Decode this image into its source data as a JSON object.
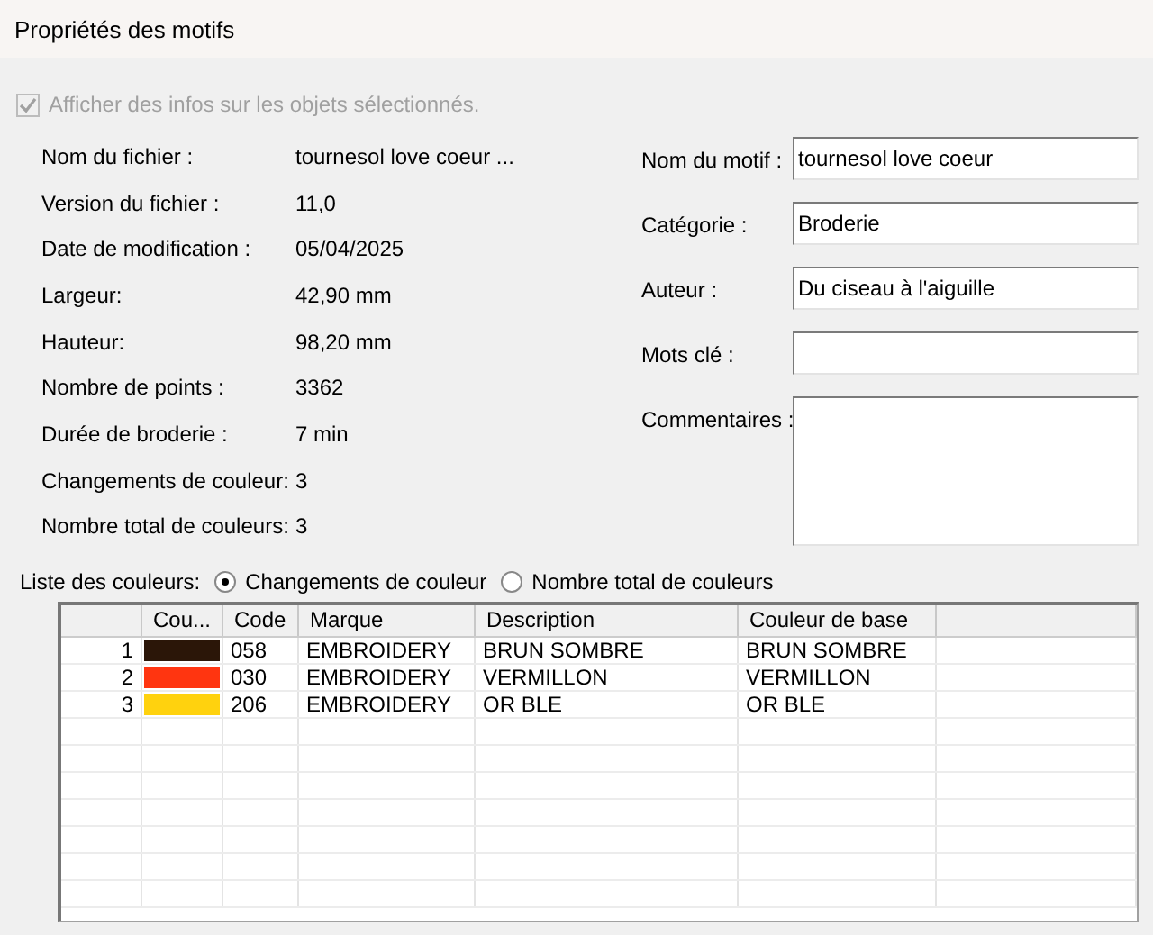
{
  "window": {
    "title": "Propriétés des motifs"
  },
  "show_info": {
    "label": "Afficher des infos sur les objets sélectionnés.",
    "checked": true,
    "disabled": true
  },
  "info": [
    {
      "label": "Nom du fichier :",
      "value": "tournesol love coeur ..."
    },
    {
      "label": "Version du fichier :",
      "value": "11,0"
    },
    {
      "label": "Date de modification :",
      "value": "05/04/2025"
    },
    {
      "label": "Largeur:",
      "value": "42,90 mm"
    },
    {
      "label": "Hauteur:",
      "value": "98,20 mm"
    },
    {
      "label": "Nombre de points :",
      "value": "3362"
    },
    {
      "label": "Durée de broderie :",
      "value": "7 min"
    },
    {
      "label": "Changements de couleur:",
      "value": "3"
    },
    {
      "label": "Nombre total de couleurs:",
      "value": "3"
    }
  ],
  "fields": [
    {
      "label": "Nom du motif :",
      "value": "tournesol love coeur",
      "kind": "line"
    },
    {
      "label": "Catégorie :",
      "value": "Broderie",
      "kind": "line"
    },
    {
      "label": "Auteur :",
      "value": "Du ciseau à l'aiguille",
      "kind": "line"
    },
    {
      "label": "Mots clé :",
      "kind": "line"
    },
    {
      "label": "Commentaires :",
      "kind": "area"
    }
  ],
  "color_list": {
    "label": "Liste des couleurs:",
    "options": [
      {
        "label": "Changements de couleur",
        "selected": true
      },
      {
        "label": "Nombre total de couleurs",
        "selected": false
      }
    ]
  },
  "table": {
    "columns": [
      "Cou...",
      "Code",
      "Marque",
      "Description",
      "Couleur de base"
    ],
    "rows": [
      {
        "number": "1",
        "color": "#2b1608",
        "code": "058",
        "brand": "EMBROIDERY",
        "description": "BRUN SOMBRE",
        "base": "BRUN SOMBRE"
      },
      {
        "number": "2",
        "color": "#ff3510",
        "code": "030",
        "brand": "EMBROIDERY",
        "description": "VERMILLON",
        "base": "VERMILLON"
      },
      {
        "number": "3",
        "color": "#ffd20e",
        "code": "206",
        "brand": "EMBROIDERY",
        "description": "OR BLE",
        "base": "OR BLE"
      }
    ]
  }
}
